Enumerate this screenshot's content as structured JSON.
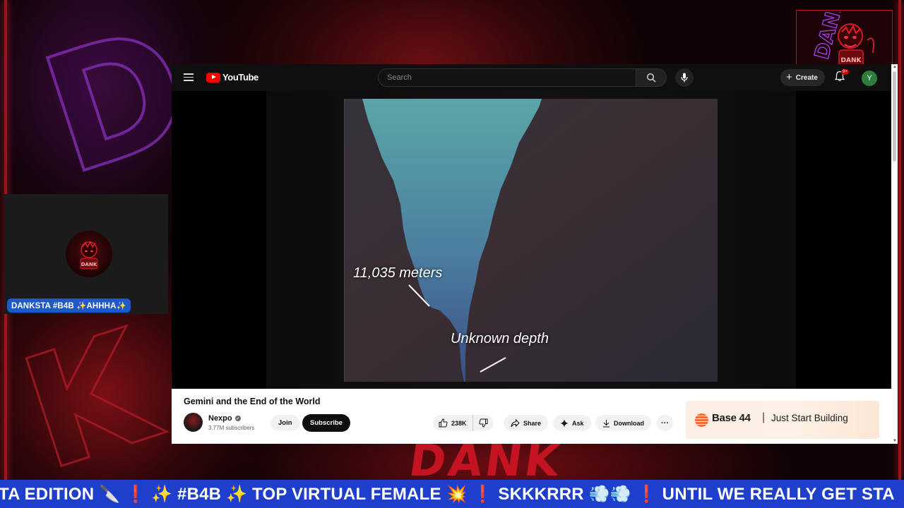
{
  "overlay": {
    "background_letters": "DANK",
    "webcam_tag": "DANKSTA #B4B ✨AHHHA✨",
    "ticker": "TA EDITION 🔪 ❗ ✨ #B4B ✨ TOP VIRTUAL FEMALE 💥 ❗ SKKKRRR 💨💨 ❗ UNTIL WE REALLY GET STA",
    "colors": {
      "accent_red": "#c41422",
      "ticker_blue": "#1d3fcc",
      "purple": "#8a2fbf"
    }
  },
  "youtube": {
    "logo_text": "YouTube",
    "search": {
      "placeholder": "Search"
    },
    "create_label": "Create",
    "notification_badge": "9+",
    "avatar_letter": "Y",
    "video": {
      "label_depth": "11,035 meters",
      "label_unknown": "Unknown depth"
    },
    "title": "Gemini and the End of the World",
    "channel": {
      "name": "Nexpo",
      "subscribers": "3.77M subscribers"
    },
    "buttons": {
      "join": "Join",
      "subscribe": "Subscribe",
      "likes": "238K",
      "share": "Share",
      "ask": "Ask",
      "download": "Download",
      "more": "···"
    },
    "ad": {
      "brand": "Base 44",
      "separator": "|",
      "tagline": "Just Start Building"
    }
  }
}
